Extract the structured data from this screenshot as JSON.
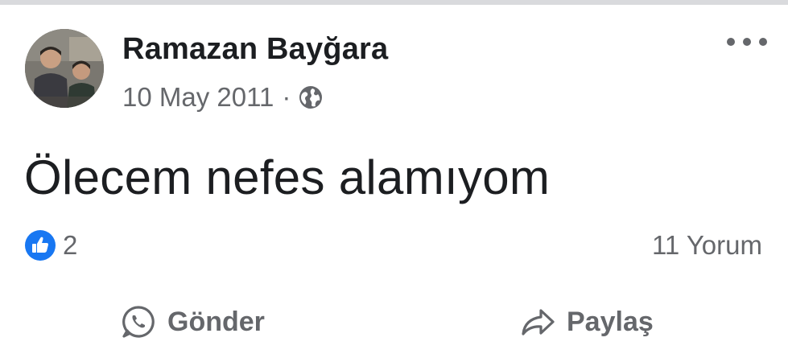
{
  "post": {
    "author": "Ramazan Bayğara",
    "date": "10 May 2011",
    "separator": "·",
    "privacy_icon": "globe-icon",
    "more_icon": "more-horizontal-icon",
    "text": "Ölecem nefes alamıyom"
  },
  "stats": {
    "reaction_icon": "like-icon",
    "reaction_count": "2",
    "comments": "11 Yorum"
  },
  "actions": {
    "send_label": "Gönder",
    "send_icon": "whatsapp-icon",
    "share_label": "Paylaş",
    "share_icon": "share-arrow-icon"
  },
  "colors": {
    "text_primary": "#1c1e21",
    "text_secondary": "#65676b",
    "like_blue": "#1877f2",
    "divider": "#d9dadd"
  }
}
